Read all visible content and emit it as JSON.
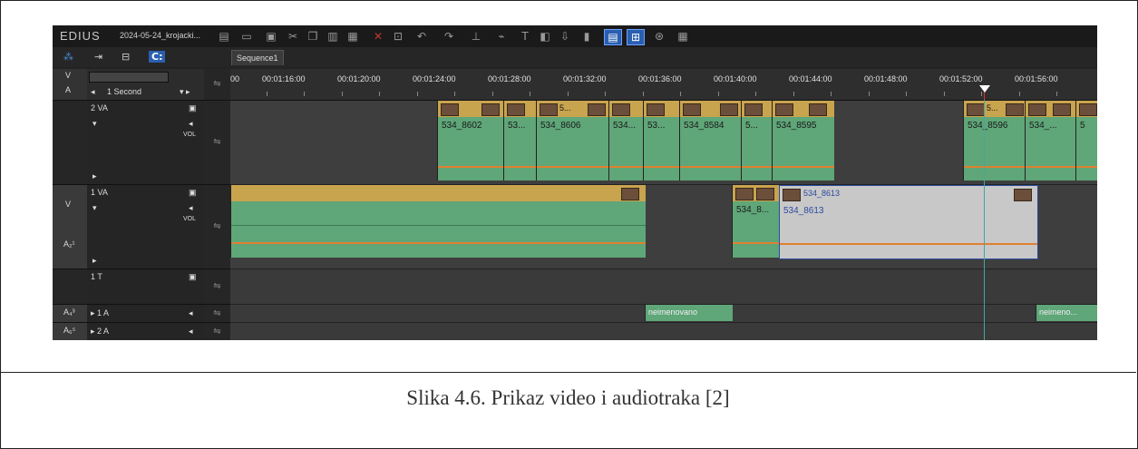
{
  "app": {
    "logo": "EDIUS",
    "project": "2024-05-24_krojacki..."
  },
  "tab": {
    "sequence": "Sequence1"
  },
  "scale": {
    "label": "1 Second"
  },
  "ruler": {
    "ticks": [
      "00",
      "00:01:16:00",
      "00:01:20:00",
      "00:01:24:00",
      "00:01:28:00",
      "00:01:32:00",
      "00:01:36:00",
      "00:01:40:00",
      "00:01:44:00",
      "00:01:48:00",
      "00:01:52:00",
      "00:01:56:00"
    ]
  },
  "headers": {
    "va": {
      "col1": "V",
      "col1b": "A",
      "name": "2 VA",
      "vol": "VOL"
    },
    "va1": {
      "col1": "V",
      "col1b": "A₂¹",
      "name": "1 VA",
      "vol": "VOL"
    },
    "t1": {
      "name": "1 T"
    },
    "a1": {
      "col1": "A₄³",
      "name": "▸ 1 A"
    },
    "a2": {
      "col1": "A₆⁵",
      "name": "▸ 2 A"
    }
  },
  "clips": {
    "track2": [
      "534_8602",
      "53...",
      "534_8606",
      "534...",
      "53...",
      "534_8584",
      "5...",
      "534_8595",
      "534_8596",
      "534_...",
      "5"
    ],
    "track2_top": [
      "5...",
      "5..."
    ],
    "track1": [
      "534_8613",
      "534_8...",
      "534_8613"
    ],
    "audio": [
      "neimenovano",
      "neimeno..."
    ]
  },
  "caption": "Slika 4.6. Prikaz video i audiotraka [2]",
  "colors": {
    "clip_top": "#c9a44f",
    "clip_body": "#5fa678",
    "playhead": "#4aa3a3",
    "selected": "#c8c8c8"
  }
}
